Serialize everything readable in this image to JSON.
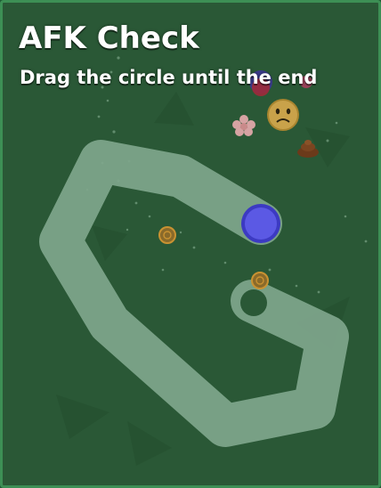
{
  "dialog": {
    "title": "AFK Check",
    "instruction": "Drag the circle until the end"
  },
  "colors": {
    "background": "#2a5836",
    "path": "#7fa68c",
    "handle": "#5b59e4",
    "handle_ring": "#3c3ac2",
    "end_marker": "#2a5836",
    "coin": "#c99232",
    "face_mob": "#c9a24a",
    "poop": "#6b3a1a",
    "flower": "#d6a3a3"
  },
  "icons": {
    "handle": "drag-circle-icon",
    "end_marker": "end-ring-icon",
    "mob_face": "frowning-face-icon",
    "poop": "poop-icon",
    "flower": "flower-icon",
    "coin": "coin-icon"
  }
}
